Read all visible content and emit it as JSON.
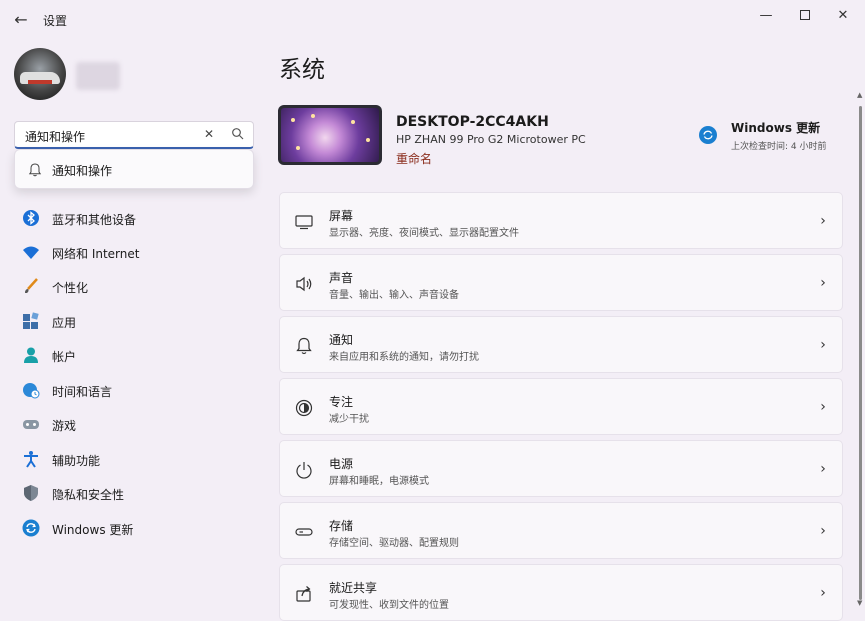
{
  "window": {
    "title": "设置",
    "back_icon": "arrow-left-icon",
    "controls": [
      "minimize-icon",
      "maximize-icon",
      "close-icon"
    ]
  },
  "search": {
    "value": "通知和操作",
    "clear_icon": "close-icon",
    "search_icon": "search-icon",
    "suggestions": [
      {
        "label": "通知和操作",
        "icon": "bell-icon"
      }
    ]
  },
  "sidebar": {
    "items": [
      {
        "label": "蓝牙和其他设备",
        "icon": "bluetooth-icon"
      },
      {
        "label": "网络和 Internet",
        "icon": "wifi-icon"
      },
      {
        "label": "个性化",
        "icon": "brush-icon"
      },
      {
        "label": "应用",
        "icon": "apps-icon"
      },
      {
        "label": "帐户",
        "icon": "person-icon"
      },
      {
        "label": "时间和语言",
        "icon": "globe-clock-icon"
      },
      {
        "label": "游戏",
        "icon": "gamepad-icon"
      },
      {
        "label": "辅助功能",
        "icon": "accessibility-icon"
      },
      {
        "label": "隐私和安全性",
        "icon": "shield-icon"
      },
      {
        "label": "Windows 更新",
        "icon": "windows-update-icon"
      }
    ]
  },
  "main": {
    "title": "系统",
    "device": {
      "name": "DESKTOP-2CC4AKH",
      "model": "HP ZHAN 99 Pro G2 Microtower PC",
      "rename": "重命名"
    },
    "windows_update": {
      "title": "Windows 更新",
      "subtitle": "上次检查时间: 4 小时前"
    },
    "cards": [
      {
        "title": "屏幕",
        "subtitle": "显示器、亮度、夜间模式、显示器配置文件",
        "icon": "monitor-icon"
      },
      {
        "title": "声音",
        "subtitle": "音量、输出、输入、声音设备",
        "icon": "speaker-icon"
      },
      {
        "title": "通知",
        "subtitle": "来自应用和系统的通知，请勿打扰",
        "icon": "bell-icon"
      },
      {
        "title": "专注",
        "subtitle": "减少干扰",
        "icon": "focus-icon"
      },
      {
        "title": "电源",
        "subtitle": "屏幕和睡眠，电源模式",
        "icon": "power-icon"
      },
      {
        "title": "存储",
        "subtitle": "存储空间、驱动器、配置规则",
        "icon": "storage-icon"
      },
      {
        "title": "就近共享",
        "subtitle": "可发现性、收到文件的位置",
        "icon": "share-icon"
      }
    ]
  },
  "colors": {
    "background": "#f3eef6",
    "accent": "#3b62b0",
    "rename_link": "#8a2c1c",
    "update_icon": "#1a7fd0"
  }
}
